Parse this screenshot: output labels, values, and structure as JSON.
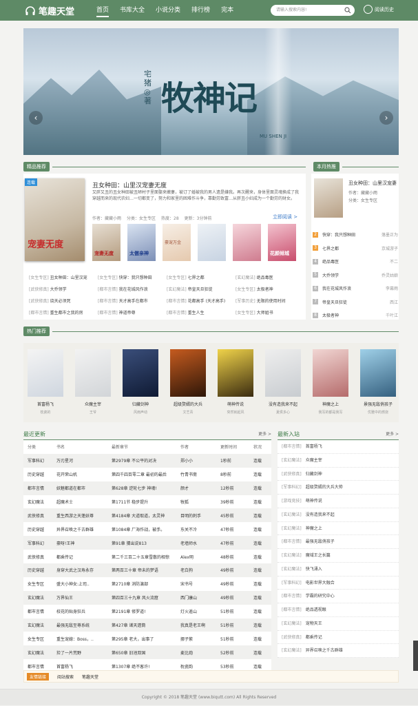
{
  "header": {
    "logo": "笔趣天堂",
    "nav": [
      "首页",
      "书库大全",
      "小说分类",
      "排行榜",
      "完本"
    ],
    "search_placeholder": "请输入搜索内容!",
    "history": "阅读历史"
  },
  "banner": {
    "title": "牧神记",
    "author_line": "宅猪◎著",
    "pinyin": "MU SHEN JI",
    "prev": "‹",
    "next": "›"
  },
  "featured": {
    "section_title": "精品推荐",
    "book": {
      "title": "丑女种田：山里汉宠妻无度",
      "tag": "连载",
      "cover_text": "宠妻无度",
      "desc": "又胖又丑的丑女种田被丑陋村子里面娶来嫩妻，被订了婚被我的男人遗是嫌我。再次醒来，身体里面灵魂换成了我穿越而来的现代农妇…一切都变了，努力和家里的困难作斗争，靠勤劳致富…从胖丑小妇成为一个勤劳的财女。",
      "author": "作者：藏藏小雨",
      "category": "分类：女生专区",
      "hits": "热度：28",
      "update": "更新：3分钟前",
      "read": "立即阅读 >"
    },
    "thumb_labels": [
      "宠妻无度",
      "太傲亲神",
      "豪宠万金",
      "",
      "",
      "花颜倾城"
    ]
  },
  "featured_list": [
    {
      "cat": "[女生专区]",
      "name": "丑女种田：山里汉宠"
    },
    {
      "cat": "[女生专区]",
      "name": "快穿：我只想种田"
    },
    {
      "cat": "[女生专区]",
      "name": "七界之都"
    },
    {
      "cat": "[玄幻魔法]",
      "name": "绝品毒医"
    },
    {
      "cat": "[武侠修真]",
      "name": "大乔领学"
    },
    {
      "cat": "[都市言情]",
      "name": "我在花城风作浪"
    },
    {
      "cat": "[玄幻魔法]",
      "name": "帝皇天旦狂徒"
    },
    {
      "cat": "[女生专区]",
      "name": "太极者神"
    },
    {
      "cat": "[武侠修真]",
      "name": "烧天必须死"
    },
    {
      "cat": "[都市言情]",
      "name": "天才高手在都市"
    },
    {
      "cat": "[都市言情]",
      "name": "花都高手 (天才高手)"
    },
    {
      "cat": "[军事历史]",
      "name": "无限的使用时间"
    },
    {
      "cat": "[都市言情]",
      "name": "重生都市之我的房"
    },
    {
      "cat": "[都市言情]",
      "name": "神道帝尊"
    },
    {
      "cat": "[都市言情]",
      "name": "重生人生"
    },
    {
      "cat": "[女生专区]",
      "name": "大师姐书"
    }
  ],
  "ranking": {
    "section_title": "本月热推",
    "top": {
      "title": "丑女种田：山里汉宠妻",
      "author": "作者：藏藏小雨",
      "category": "分类：女生专区"
    },
    "items": [
      {
        "num": "2",
        "name": "快穿：我只想种田",
        "author": "落墨正为"
      },
      {
        "num": "3",
        "name": "七界之都",
        "author": "京城游子"
      },
      {
        "num": "4",
        "name": "绝品毒医",
        "author": "不二"
      },
      {
        "num": "5",
        "name": "大乔领学",
        "author": "乔灵姑娘"
      },
      {
        "num": "6",
        "name": "我在花城风作浪",
        "author": "李幕雨"
      },
      {
        "num": "7",
        "name": "帝皇天旦狂徒",
        "author": "西江"
      },
      {
        "num": "8",
        "name": "太极者神",
        "author": "千叶江"
      }
    ]
  },
  "hot": {
    "section_title": "热门推荐",
    "items": [
      {
        "name": "首富杨飞",
        "author": "枕瓷的"
      },
      {
        "name": "众魔主宰",
        "author": "王爷"
      },
      {
        "name": "归藏剑神",
        "author": "风雨声动"
      },
      {
        "name": "超级赘婿的大兵",
        "author": "文艺青"
      },
      {
        "name": "萌神传说",
        "author": "突然就起风"
      },
      {
        "name": "没有造我来不起",
        "author": "夏侯多心"
      },
      {
        "name": "神魔之上",
        "author": "我写的都是我写"
      },
      {
        "name": "景强无敌俏孩子",
        "author": "优雅中的燃烧"
      }
    ]
  },
  "latest": {
    "title": "最近更新",
    "more": "更多 >",
    "headers": [
      "分类",
      "书名",
      "最新章节",
      "作者",
      "更新时间",
      "状况"
    ],
    "rows": [
      [
        "军事科幻",
        "万刃星河",
        "第2979章 不公平的对决",
        "郑小小",
        "1秒前",
        "连载"
      ],
      [
        "历史穿越",
        "花开荣山机",
        "第四千四百零二章 最初的最后",
        "竹青书斋",
        "8秒前",
        "连载"
      ],
      [
        "都市言情",
        "妖魅都道在都市",
        "第628章 逆轮七步 神魂!",
        "颜才",
        "12秒前",
        "连载"
      ],
      [
        "玄幻魔法",
        "超魔术士",
        "第1711节 稳步提升",
        "牧狐",
        "39秒前",
        "连载"
      ],
      [
        "武侠修真",
        "重生西游之天蓬妖尊",
        "第4184章 大道取道，太灵神",
        "目明的刺手",
        "45秒前",
        "连载"
      ],
      [
        "历史穿越",
        "异界召唤之千古群雄",
        "第1084章 厂海作战，被手。",
        "东关不冷",
        "47秒前",
        "连载"
      ],
      [
        "军事科幻",
        "豪呀!王神",
        "第91章 猜出说813",
        "老墙师水",
        "47秒前",
        "连载"
      ],
      [
        "武侠修真",
        "都乘传记",
        "第二千三百二十五章雪散的相惊",
        "Alex明",
        "48秒前",
        "连载"
      ],
      [
        "历史穿越",
        "身穿大武之汉寿永存",
        "第两百三十章 帝未的梦语",
        "老白狗",
        "49秒前",
        "连载"
      ],
      [
        "女生专区",
        "盛大小神女:上司..",
        "第2710章 消防演部",
        "宋书号",
        "49秒前",
        "连载"
      ],
      [
        "玄幻魔法",
        "万界仙王",
        "第四百三十九章 风火流窟",
        "西门康山",
        "49秒前",
        "连载"
      ],
      [
        "都市言情",
        "校花的贴身狂兵",
        "第2191章 修罗道!",
        "灯火遥山",
        "51秒前",
        "连载"
      ],
      [
        "玄幻魔法",
        "最强无敌至尊系统",
        "第427章 诸天遗筒",
        "我真是老王啊",
        "51秒前",
        "连载"
      ],
      [
        "女生专区",
        "重生宠媳：Boss，..",
        "第295章 老大，出事了",
        "挪子紫",
        "51秒前",
        "连载"
      ],
      [
        "玄幻魔法",
        "捡了一片荒野",
        "第650章 旧池双国",
        "麦比炮",
        "52秒前",
        "连载"
      ],
      [
        "都市言情",
        "首富杨飞",
        "第1307章 绝不客许!",
        "枕瓷韵",
        "53秒前",
        "连载"
      ]
    ]
  },
  "newbooks": {
    "title": "最新入站",
    "more": "更多 >",
    "items": [
      {
        "cat": "[都市言情]",
        "name": "首富杨飞"
      },
      {
        "cat": "[玄幻魔法]",
        "name": "众魔主宰"
      },
      {
        "cat": "[武侠修真]",
        "name": "归藏剑神"
      },
      {
        "cat": "[军事科幻]",
        "name": "超级赘婿的大兵大帅"
      },
      {
        "cat": "[游戏竞技]",
        "name": "萌神传说"
      },
      {
        "cat": "[玄幻魔法]",
        "name": "没有造我来不起"
      },
      {
        "cat": "[玄幻魔法]",
        "name": "神魔之上"
      },
      {
        "cat": "[都市言情]",
        "name": "最强无敌俏孩子"
      },
      {
        "cat": "[玄幻魔法]",
        "name": "魔域王之长篇"
      },
      {
        "cat": "[玄幻魔法]",
        "name": "快飞涌入"
      },
      {
        "cat": "[军事科幻]",
        "name": "电影世界大融合"
      },
      {
        "cat": "[都市言情]",
        "name": "学霸的研究中心"
      },
      {
        "cat": "[都市言情]",
        "name": "绝品透视眼"
      },
      {
        "cat": "[玄幻魔法]",
        "name": "宠物天王"
      },
      {
        "cat": "[武侠修真]",
        "name": "都乘传记"
      },
      {
        "cat": "[玄幻魔法]",
        "name": "异界召唤之千古群雄"
      }
    ]
  },
  "friend_links": {
    "label": "友情链接",
    "links": [
      "阅站搜索",
      "笔趣天堂"
    ]
  },
  "footer": "Copyright © 2018 笔趣天堂 (www.biqutt.com) All Rights Reserved"
}
